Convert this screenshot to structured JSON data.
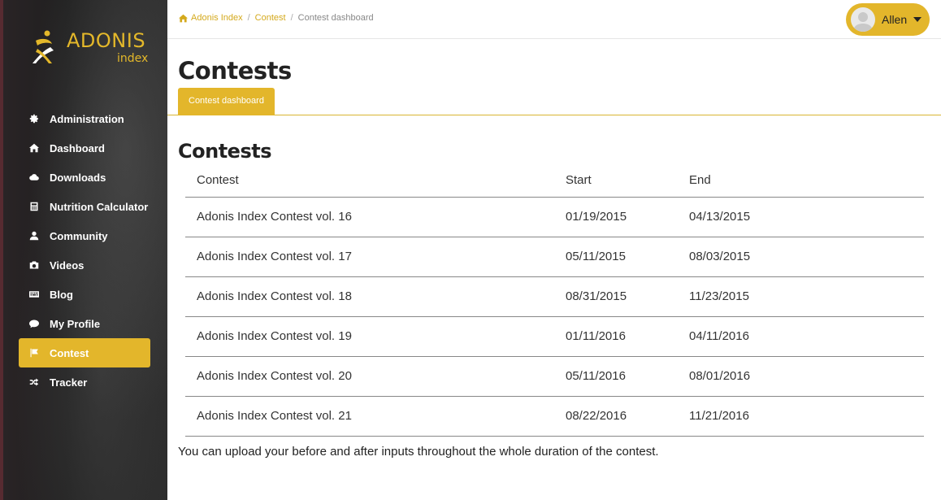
{
  "brand": {
    "name": "ADONIS",
    "sub": "index"
  },
  "sidebar": {
    "items": [
      {
        "label": "Administration",
        "icon": "gear-icon",
        "active": false
      },
      {
        "label": "Dashboard",
        "icon": "home-icon",
        "active": false
      },
      {
        "label": "Downloads",
        "icon": "cloud-icon",
        "active": false
      },
      {
        "label": "Nutrition Calculator",
        "icon": "calculator-icon",
        "active": false
      },
      {
        "label": "Community",
        "icon": "user-icon",
        "active": false
      },
      {
        "label": "Videos",
        "icon": "camera-icon",
        "active": false
      },
      {
        "label": "Blog",
        "icon": "keyboard-icon",
        "active": false
      },
      {
        "label": "My Profile",
        "icon": "comment-icon",
        "active": false
      },
      {
        "label": "Contest",
        "icon": "flag-icon",
        "active": true
      },
      {
        "label": "Tracker",
        "icon": "shuffle-icon",
        "active": false
      }
    ]
  },
  "breadcrumb": {
    "home": "Adonis Index",
    "section": "Contest",
    "current": "Contest dashboard",
    "separator": "/"
  },
  "user": {
    "name": "Allen"
  },
  "page": {
    "title": "Contests",
    "tab": "Contest dashboard"
  },
  "contests": {
    "title": "Contests",
    "headers": {
      "contest": "Contest",
      "start": "Start",
      "end": "End"
    },
    "rows": [
      {
        "name": "Adonis Index Contest vol. 16",
        "start": "01/19/2015",
        "end": "04/13/2015"
      },
      {
        "name": "Adonis Index Contest vol. 17",
        "start": "05/11/2015",
        "end": "08/03/2015"
      },
      {
        "name": "Adonis Index Contest vol. 18",
        "start": "08/31/2015",
        "end": "11/23/2015"
      },
      {
        "name": "Adonis Index Contest vol. 19",
        "start": "01/11/2016",
        "end": "04/11/2016"
      },
      {
        "name": "Adonis Index Contest vol. 20",
        "start": "05/11/2016",
        "end": "08/01/2016"
      },
      {
        "name": "Adonis Index Contest vol. 21",
        "start": "08/22/2016",
        "end": "11/21/2016"
      }
    ],
    "note": "You can upload your before and after inputs throughout the whole duration of the contest."
  },
  "colors": {
    "accent": "#e3b62b",
    "sidebar_bg": "#222222",
    "text": "#222222"
  }
}
